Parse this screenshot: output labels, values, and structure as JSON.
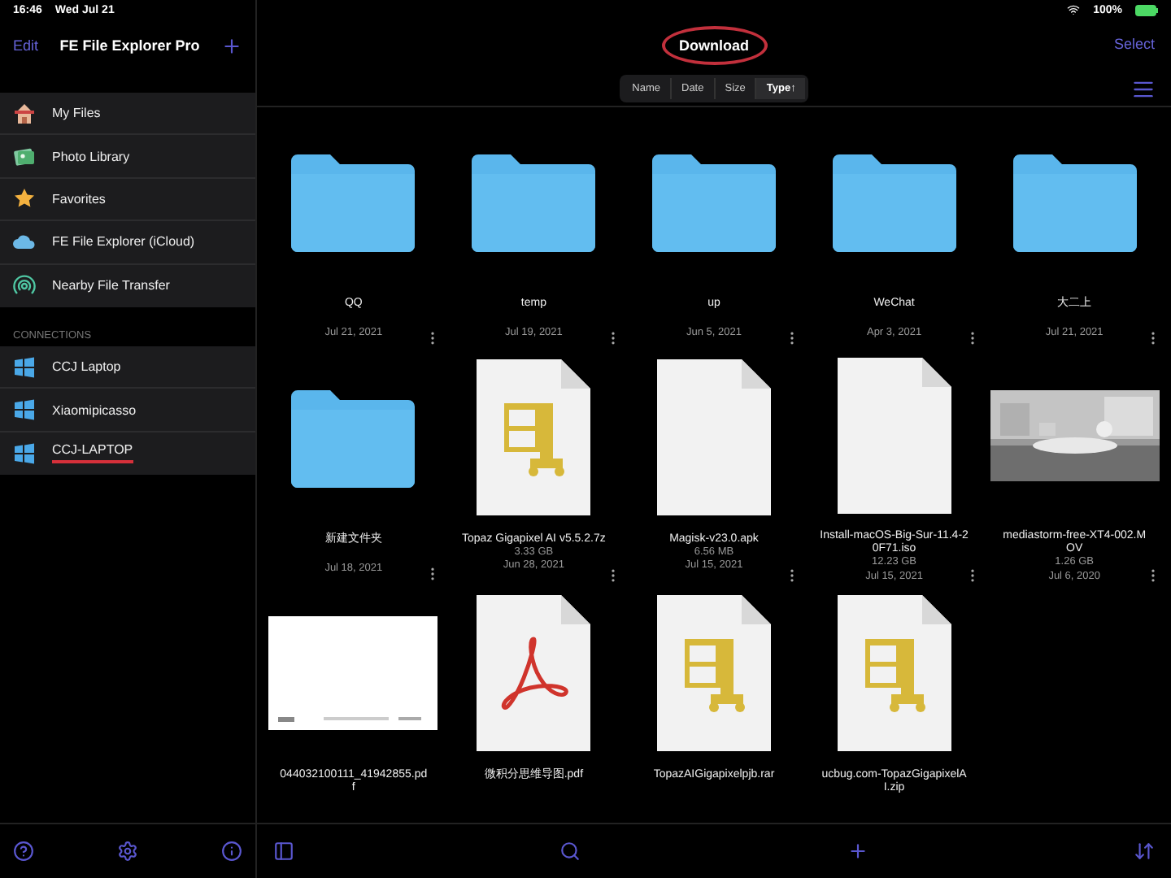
{
  "status_bar": {
    "time": "16:46",
    "date": "Wed Jul 21",
    "battery": "100%"
  },
  "sidebar": {
    "edit": "Edit",
    "title": "FE File Explorer Pro",
    "items": [
      {
        "label": "My Files",
        "kind": "home"
      },
      {
        "label": "Photo Library",
        "kind": "photos"
      },
      {
        "label": "Favorites",
        "kind": "star"
      },
      {
        "label": "FE File Explorer (iCloud)",
        "kind": "cloud"
      },
      {
        "label": "Nearby File Transfer",
        "kind": "nearby"
      }
    ],
    "connections_header": "CONNECTIONS",
    "connections": [
      {
        "label": "CCJ Laptop",
        "marked": false
      },
      {
        "label": "Xiaomipicasso",
        "marked": false
      },
      {
        "label": "CCJ-LAPTOP",
        "marked": true
      }
    ]
  },
  "main": {
    "title": "Download",
    "title_marked": true,
    "select": "Select",
    "sort": [
      {
        "label": "Name",
        "selected": false
      },
      {
        "label": "Date",
        "selected": false
      },
      {
        "label": "Size",
        "selected": false
      },
      {
        "label": "Type↑",
        "selected": true
      }
    ],
    "files": [
      {
        "kind": "folder",
        "name": "QQ",
        "date": "Jul 21, 2021"
      },
      {
        "kind": "folder",
        "name": "temp",
        "date": "Jul 19, 2021"
      },
      {
        "kind": "folder",
        "name": "up",
        "date": "Jun 5, 2021"
      },
      {
        "kind": "folder",
        "name": "WeChat",
        "date": "Apr 3, 2021"
      },
      {
        "kind": "folder",
        "name": "大二上",
        "date": "Jul 21, 2021"
      },
      {
        "kind": "folder",
        "name": "新建文件夹",
        "date": "Jul 18, 2021"
      },
      {
        "kind": "archive",
        "name": "Topaz Gigapixel AI v5.5.2.7z",
        "size": "3.33 GB",
        "date": "Jun 28, 2021"
      },
      {
        "kind": "blank",
        "name": "Magisk-v23.0.apk",
        "size": "6.56 MB",
        "date": "Jul 15, 2021"
      },
      {
        "kind": "blank",
        "name": "Install-macOS-Big-Sur-11.4-20F71.iso",
        "size": "12.23 GB",
        "date": "Jul 15, 2021"
      },
      {
        "kind": "video",
        "name": "mediastorm-free-XT4-002.MOV",
        "size": "1.26 GB",
        "date": "Jul 6, 2020"
      },
      {
        "kind": "page",
        "name": "044032100111_41942855.pdf"
      },
      {
        "kind": "pdf",
        "name": "微积分思维导图.pdf"
      },
      {
        "kind": "archive",
        "name": "TopazAIGigapixelpjb.rar"
      },
      {
        "kind": "archive",
        "name": "ucbug.com-TopazGigapixelAI.zip"
      }
    ]
  }
}
